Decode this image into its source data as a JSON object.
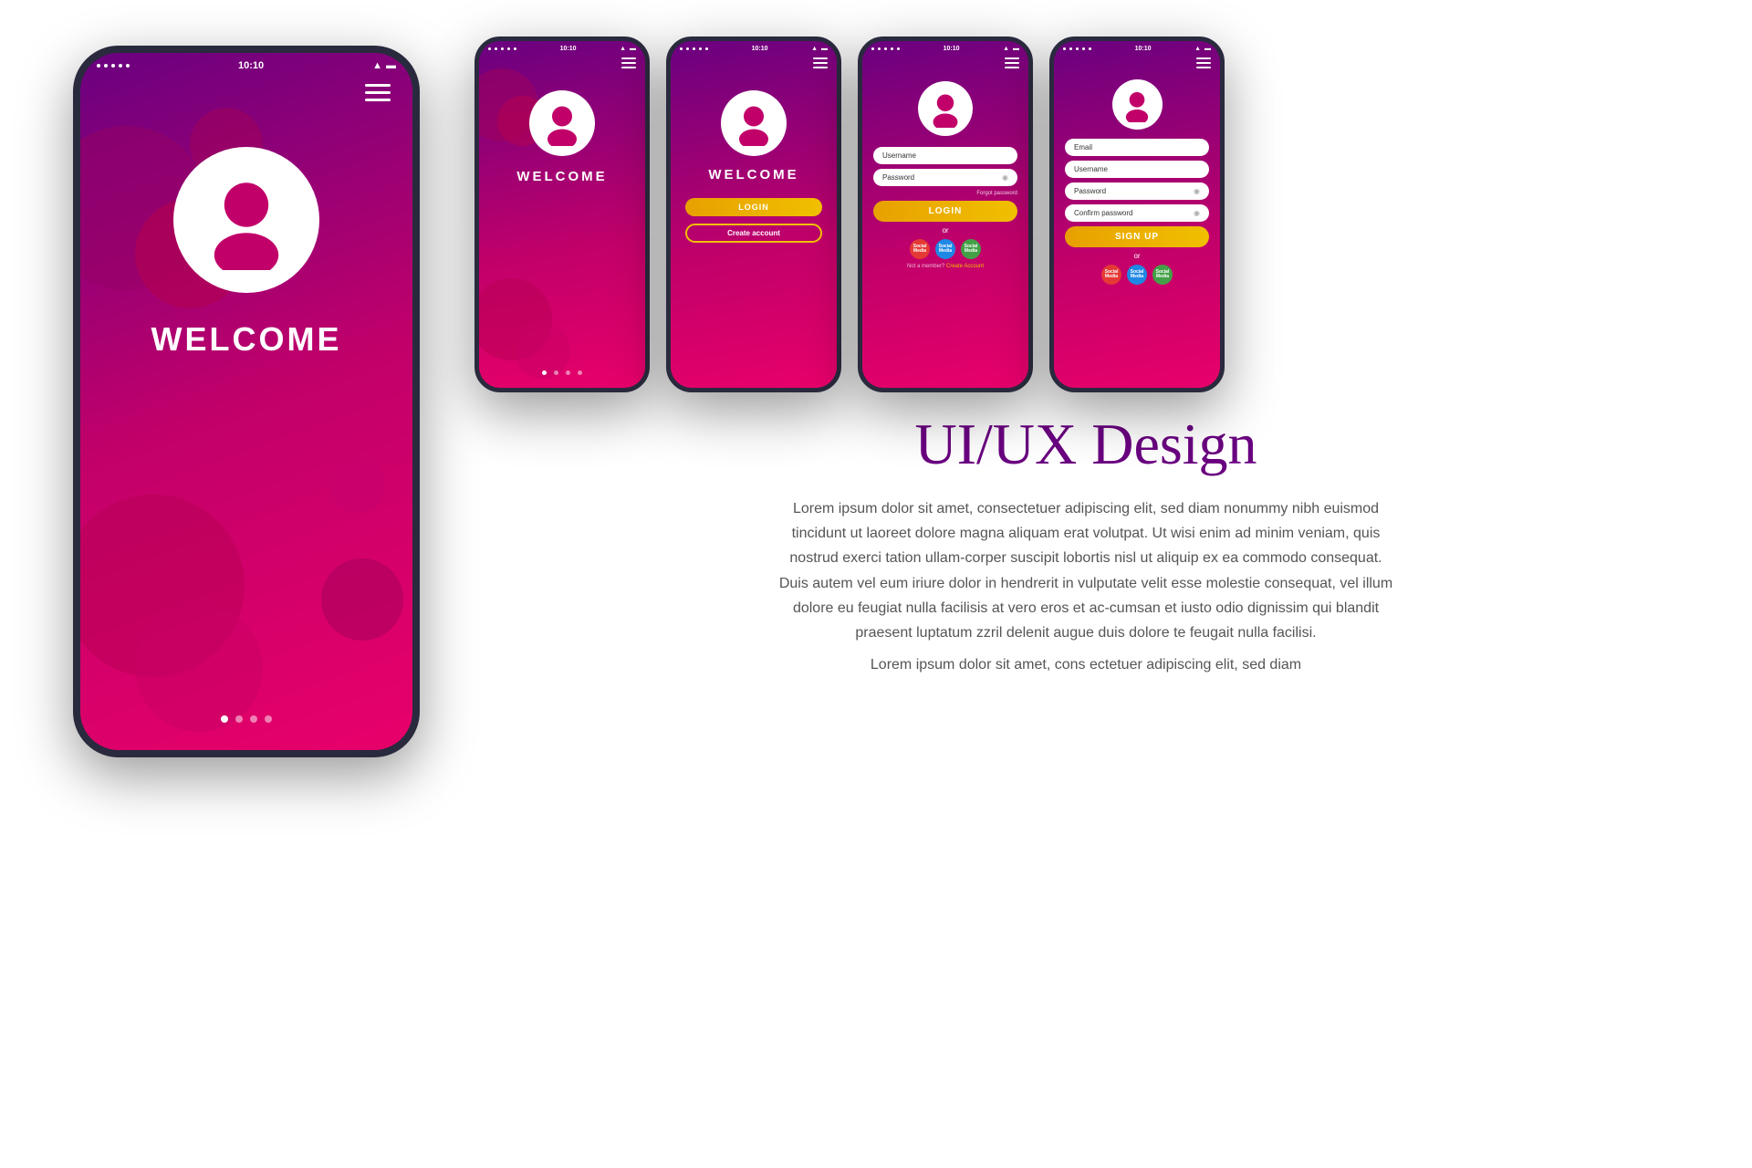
{
  "page": {
    "background": "#ffffff"
  },
  "large_phone": {
    "status_time": "10:10",
    "welcome": "WELCOME",
    "dot_count": 4,
    "active_dot": 0
  },
  "phone2": {
    "status_time": "10:10",
    "welcome": "WELCOME",
    "dot_count": 4,
    "active_dot": 0
  },
  "phone3": {
    "status_time": "10:10",
    "welcome": "WELCOME",
    "login_btn": "Login",
    "create_btn": "Create account"
  },
  "phone4": {
    "status_time": "10:10",
    "username_placeholder": "Username",
    "password_placeholder": "Password",
    "login_btn": "LOGIN",
    "or_text": "or",
    "social": [
      "Social Media",
      "Social Media",
      "Social Media"
    ],
    "not_member": "Not a member?",
    "create_link": "Create Account"
  },
  "phone5": {
    "status_time": "10:10",
    "email_placeholder": "Email",
    "username_placeholder": "Username",
    "password_placeholder": "Password",
    "confirm_placeholder": "Confirm password",
    "signup_btn": "SIGN UP",
    "or_text": "or",
    "social": [
      "Social Media",
      "Social Media",
      "Social Media"
    ]
  },
  "description": {
    "title": "UI/UX Design",
    "body1": "Lorem ipsum dolor sit amet, consectetuer adipiscing elit, sed diam nonummy nibh euismod tincidunt ut laoreet dolore magna aliquam erat volutpat. Ut wisi enim ad minim veniam, quis nostrud exerci tation ullam-corper suscipit lobortis nisl ut aliquip ex ea commodo consequat. Duis autem vel eum iriure dolor in hendrerit in vulputate velit esse molestie consequat, vel illum dolore eu feugiat nulla facilisis at vero eros et ac-cumsan et iusto odio dignissim qui blandit praesent luptatum zzril delenit augue duis dolore te feugait nulla facilisi.",
    "body2": "Lorem ipsum dolor sit amet, cons ectetuer adipiscing elit, sed diam"
  },
  "colors": {
    "gradient_start": "#6a0080",
    "gradient_mid": "#c2006a",
    "gradient_end": "#e8006a",
    "title_color": "#6a0080",
    "btn_gold": "#e8a000",
    "social1": "#e53935",
    "social2": "#1e88e5",
    "social3": "#43a047"
  }
}
